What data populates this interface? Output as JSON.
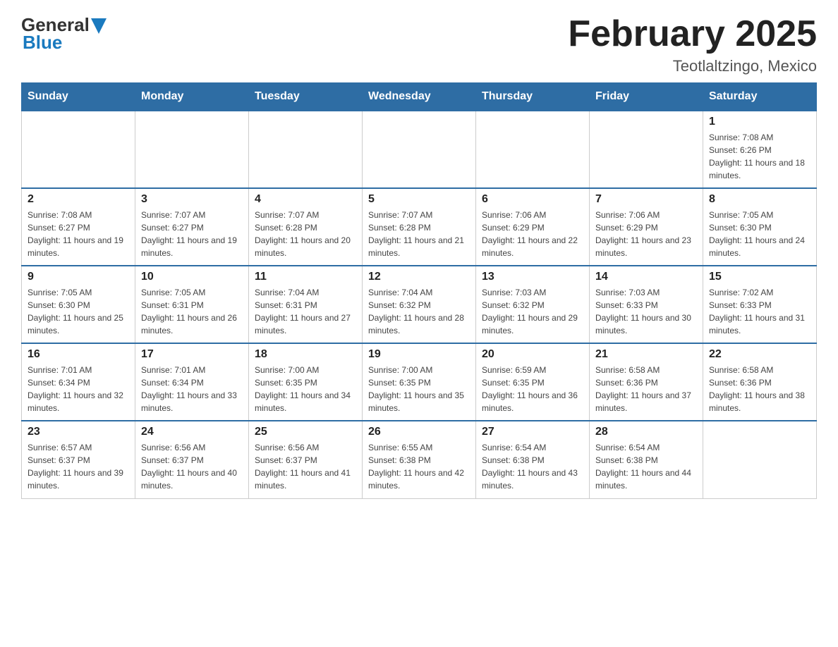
{
  "header": {
    "logo": {
      "general": "General",
      "blue": "Blue"
    },
    "title": "February 2025",
    "location": "Teotlaltzingo, Mexico"
  },
  "days_of_week": [
    "Sunday",
    "Monday",
    "Tuesday",
    "Wednesday",
    "Thursday",
    "Friday",
    "Saturday"
  ],
  "weeks": [
    [
      {
        "day": "",
        "sunrise": "",
        "sunset": "",
        "daylight": ""
      },
      {
        "day": "",
        "sunrise": "",
        "sunset": "",
        "daylight": ""
      },
      {
        "day": "",
        "sunrise": "",
        "sunset": "",
        "daylight": ""
      },
      {
        "day": "",
        "sunrise": "",
        "sunset": "",
        "daylight": ""
      },
      {
        "day": "",
        "sunrise": "",
        "sunset": "",
        "daylight": ""
      },
      {
        "day": "",
        "sunrise": "",
        "sunset": "",
        "daylight": ""
      },
      {
        "day": "1",
        "sunrise": "Sunrise: 7:08 AM",
        "sunset": "Sunset: 6:26 PM",
        "daylight": "Daylight: 11 hours and 18 minutes."
      }
    ],
    [
      {
        "day": "2",
        "sunrise": "Sunrise: 7:08 AM",
        "sunset": "Sunset: 6:27 PM",
        "daylight": "Daylight: 11 hours and 19 minutes."
      },
      {
        "day": "3",
        "sunrise": "Sunrise: 7:07 AM",
        "sunset": "Sunset: 6:27 PM",
        "daylight": "Daylight: 11 hours and 19 minutes."
      },
      {
        "day": "4",
        "sunrise": "Sunrise: 7:07 AM",
        "sunset": "Sunset: 6:28 PM",
        "daylight": "Daylight: 11 hours and 20 minutes."
      },
      {
        "day": "5",
        "sunrise": "Sunrise: 7:07 AM",
        "sunset": "Sunset: 6:28 PM",
        "daylight": "Daylight: 11 hours and 21 minutes."
      },
      {
        "day": "6",
        "sunrise": "Sunrise: 7:06 AM",
        "sunset": "Sunset: 6:29 PM",
        "daylight": "Daylight: 11 hours and 22 minutes."
      },
      {
        "day": "7",
        "sunrise": "Sunrise: 7:06 AM",
        "sunset": "Sunset: 6:29 PM",
        "daylight": "Daylight: 11 hours and 23 minutes."
      },
      {
        "day": "8",
        "sunrise": "Sunrise: 7:05 AM",
        "sunset": "Sunset: 6:30 PM",
        "daylight": "Daylight: 11 hours and 24 minutes."
      }
    ],
    [
      {
        "day": "9",
        "sunrise": "Sunrise: 7:05 AM",
        "sunset": "Sunset: 6:30 PM",
        "daylight": "Daylight: 11 hours and 25 minutes."
      },
      {
        "day": "10",
        "sunrise": "Sunrise: 7:05 AM",
        "sunset": "Sunset: 6:31 PM",
        "daylight": "Daylight: 11 hours and 26 minutes."
      },
      {
        "day": "11",
        "sunrise": "Sunrise: 7:04 AM",
        "sunset": "Sunset: 6:31 PM",
        "daylight": "Daylight: 11 hours and 27 minutes."
      },
      {
        "day": "12",
        "sunrise": "Sunrise: 7:04 AM",
        "sunset": "Sunset: 6:32 PM",
        "daylight": "Daylight: 11 hours and 28 minutes."
      },
      {
        "day": "13",
        "sunrise": "Sunrise: 7:03 AM",
        "sunset": "Sunset: 6:32 PM",
        "daylight": "Daylight: 11 hours and 29 minutes."
      },
      {
        "day": "14",
        "sunrise": "Sunrise: 7:03 AM",
        "sunset": "Sunset: 6:33 PM",
        "daylight": "Daylight: 11 hours and 30 minutes."
      },
      {
        "day": "15",
        "sunrise": "Sunrise: 7:02 AM",
        "sunset": "Sunset: 6:33 PM",
        "daylight": "Daylight: 11 hours and 31 minutes."
      }
    ],
    [
      {
        "day": "16",
        "sunrise": "Sunrise: 7:01 AM",
        "sunset": "Sunset: 6:34 PM",
        "daylight": "Daylight: 11 hours and 32 minutes."
      },
      {
        "day": "17",
        "sunrise": "Sunrise: 7:01 AM",
        "sunset": "Sunset: 6:34 PM",
        "daylight": "Daylight: 11 hours and 33 minutes."
      },
      {
        "day": "18",
        "sunrise": "Sunrise: 7:00 AM",
        "sunset": "Sunset: 6:35 PM",
        "daylight": "Daylight: 11 hours and 34 minutes."
      },
      {
        "day": "19",
        "sunrise": "Sunrise: 7:00 AM",
        "sunset": "Sunset: 6:35 PM",
        "daylight": "Daylight: 11 hours and 35 minutes."
      },
      {
        "day": "20",
        "sunrise": "Sunrise: 6:59 AM",
        "sunset": "Sunset: 6:35 PM",
        "daylight": "Daylight: 11 hours and 36 minutes."
      },
      {
        "day": "21",
        "sunrise": "Sunrise: 6:58 AM",
        "sunset": "Sunset: 6:36 PM",
        "daylight": "Daylight: 11 hours and 37 minutes."
      },
      {
        "day": "22",
        "sunrise": "Sunrise: 6:58 AM",
        "sunset": "Sunset: 6:36 PM",
        "daylight": "Daylight: 11 hours and 38 minutes."
      }
    ],
    [
      {
        "day": "23",
        "sunrise": "Sunrise: 6:57 AM",
        "sunset": "Sunset: 6:37 PM",
        "daylight": "Daylight: 11 hours and 39 minutes."
      },
      {
        "day": "24",
        "sunrise": "Sunrise: 6:56 AM",
        "sunset": "Sunset: 6:37 PM",
        "daylight": "Daylight: 11 hours and 40 minutes."
      },
      {
        "day": "25",
        "sunrise": "Sunrise: 6:56 AM",
        "sunset": "Sunset: 6:37 PM",
        "daylight": "Daylight: 11 hours and 41 minutes."
      },
      {
        "day": "26",
        "sunrise": "Sunrise: 6:55 AM",
        "sunset": "Sunset: 6:38 PM",
        "daylight": "Daylight: 11 hours and 42 minutes."
      },
      {
        "day": "27",
        "sunrise": "Sunrise: 6:54 AM",
        "sunset": "Sunset: 6:38 PM",
        "daylight": "Daylight: 11 hours and 43 minutes."
      },
      {
        "day": "28",
        "sunrise": "Sunrise: 6:54 AM",
        "sunset": "Sunset: 6:38 PM",
        "daylight": "Daylight: 11 hours and 44 minutes."
      },
      {
        "day": "",
        "sunrise": "",
        "sunset": "",
        "daylight": ""
      }
    ]
  ]
}
